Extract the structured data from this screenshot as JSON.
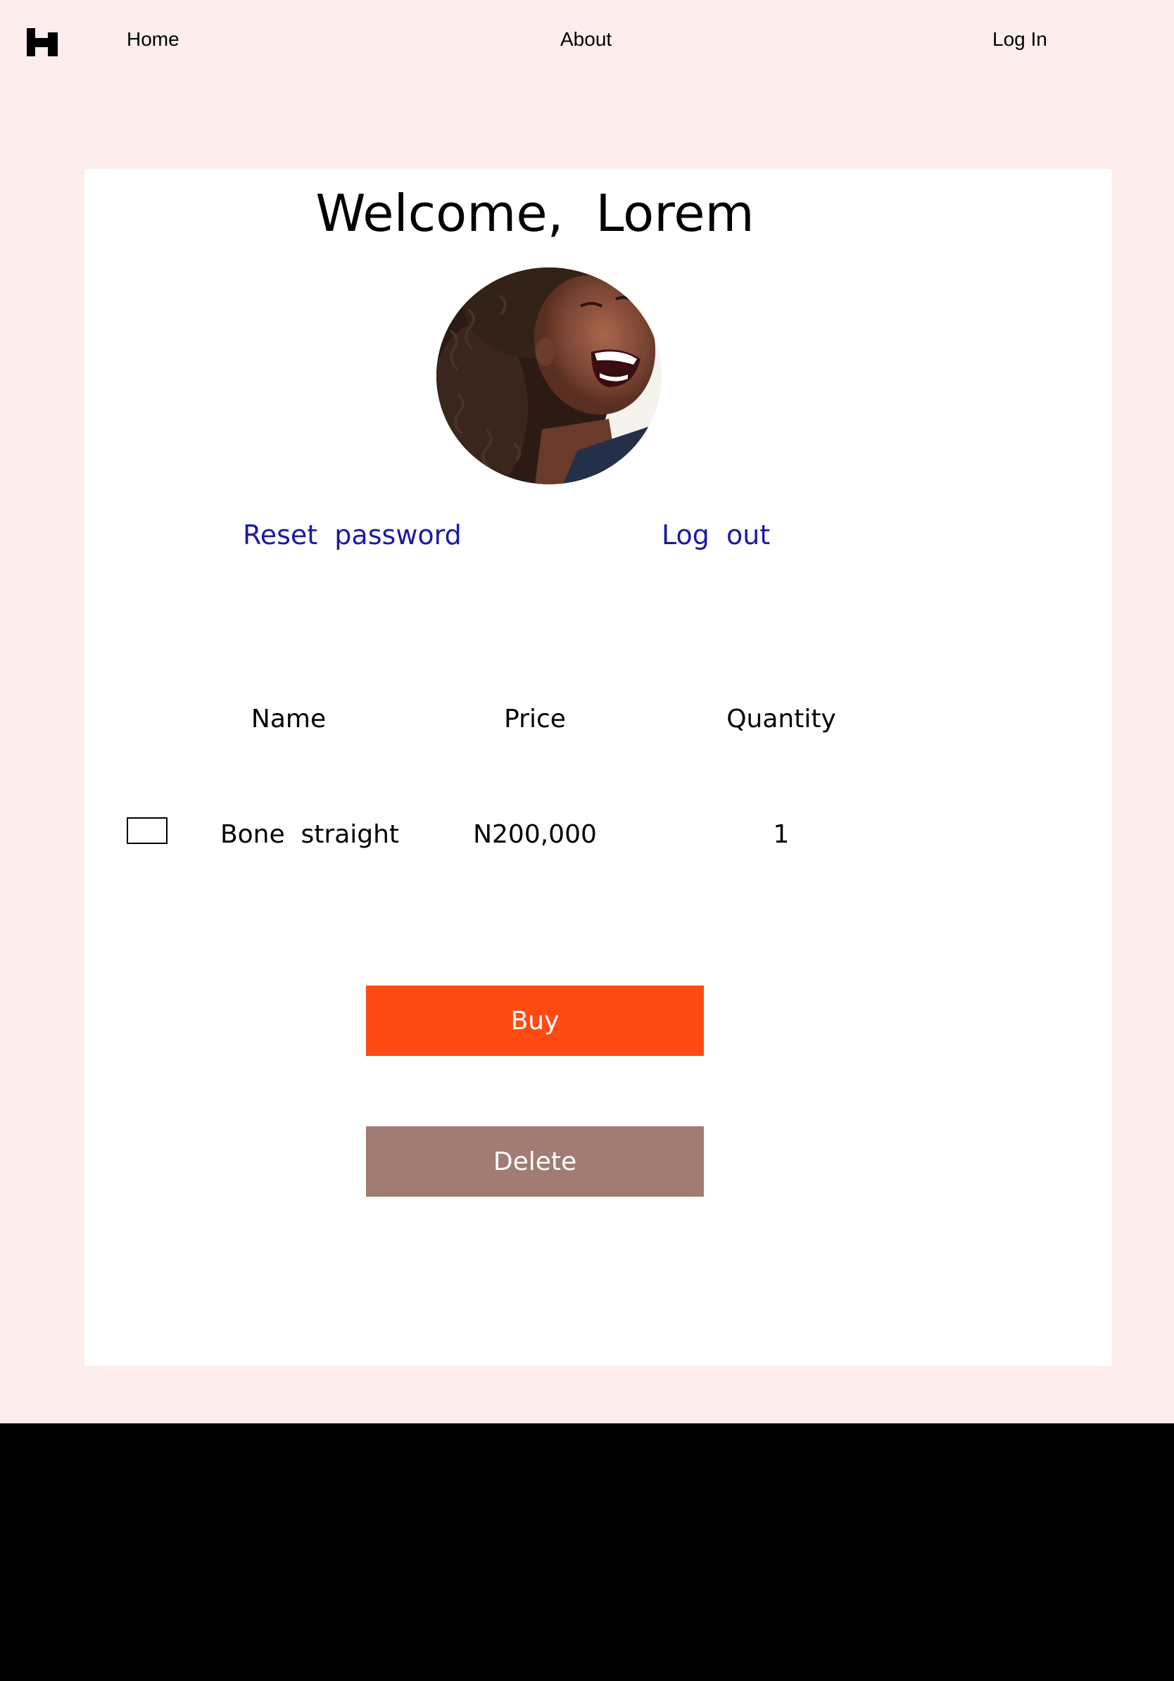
{
  "nav": {
    "logo_icon": "h-logo-icon",
    "home": "Home",
    "about": "About",
    "login": "Log In"
  },
  "profile": {
    "welcome": "Welcome,  Lorem",
    "avatar_alt": "avatar",
    "reset_password": "Reset  password",
    "log_out": "Log  out"
  },
  "cart": {
    "headers": [
      "Name",
      "Price",
      "Quantity"
    ],
    "rows": [
      {
        "name": "Bone  straight",
        "price": "N200,000",
        "quantity": "1"
      }
    ]
  },
  "actions": {
    "buy": "Buy",
    "delete": "Delete"
  },
  "colors": {
    "page_bg": "#fdeded",
    "link": "#1a1aa6",
    "buy": "#ff4a14",
    "delete": "#a27b72",
    "footer": "#000000"
  }
}
